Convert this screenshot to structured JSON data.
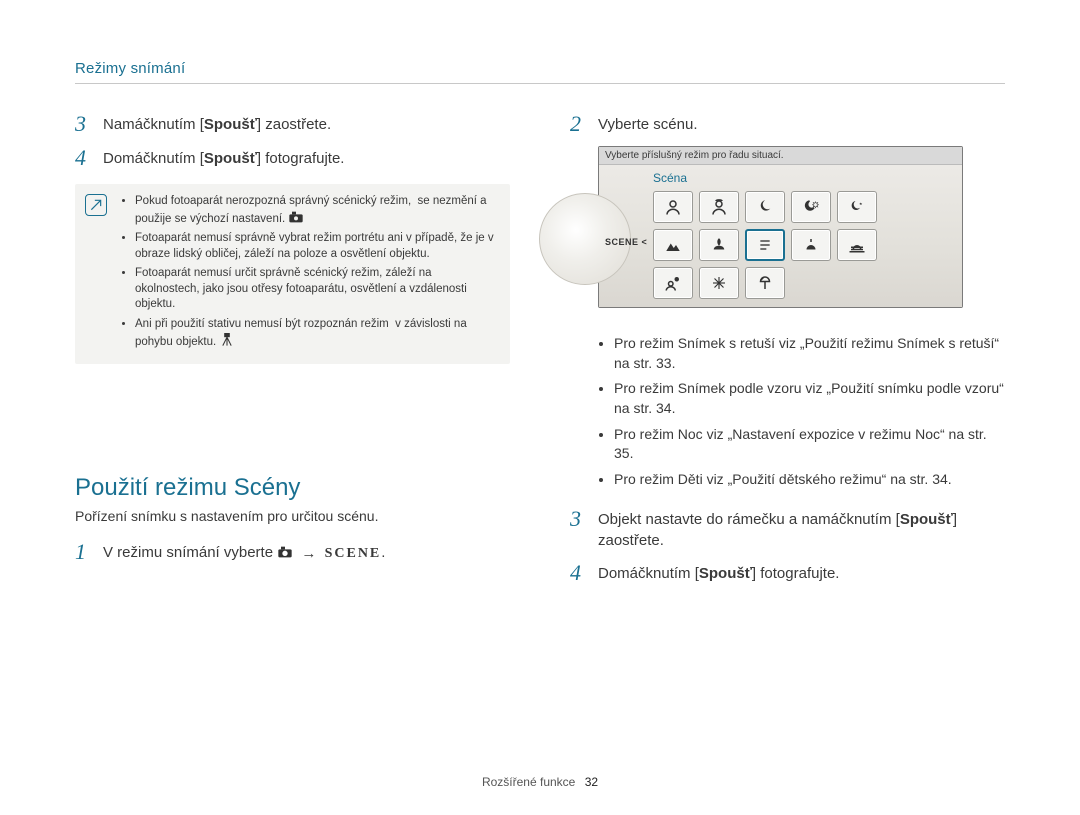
{
  "header": "Režimy snímání",
  "left": {
    "steps": [
      {
        "n": "3",
        "pre": "Namáčknutím [",
        "bold": "Spoušť",
        "post": "] zaostřete."
      },
      {
        "n": "4",
        "pre": "Domáčknutím [",
        "bold": "Spoušť",
        "post": "] fotografujte."
      }
    ],
    "notes": [
      "Pokud fotoaparát nerozpozná správný scénický režim,  se nezmění a použije se výchozí nastavení.",
      "Fotoaparát nemusí správně vybrat režim portrétu ani v případě, že je v obraze lidský obličej, záleží na poloze a osvětlení objektu.",
      "Fotoaparát nemusí určit správně scénický režim, záleží na okolnostech, jako jsou otřesy fotoaparátu, osvětlení a vzdálenosti objektu.",
      "Ani při použití stativu nemusí být rozpoznán režim  v závislosti na pohybu objektu."
    ],
    "section": {
      "title": "Použití režimu Scény",
      "desc": "Pořízení snímku s nastavením pro určitou scénu.",
      "step1": {
        "n": "1",
        "text_pre": "V režimu snímání vyberte ",
        "scene": "SCENE",
        "text_post": "."
      }
    }
  },
  "right": {
    "step2": {
      "n": "2",
      "text": "Vyberte scénu."
    },
    "display": {
      "hint": "Vyberte příslušný režim pro řadu situací.",
      "label": "Scéna",
      "side_tag": "SCENE <",
      "icons": [
        "portrait",
        "children",
        "landscape",
        "night-portrait",
        "night",
        "landscape2",
        "macro",
        "text",
        "sunset",
        "dawn",
        "backlight",
        "firework",
        "beach-snow"
      ]
    },
    "expl": [
      "Pro režim Snímek s retuší viz „Použití režimu Snímek s retuší“ na str. 33.",
      "Pro režim Snímek podle vzoru viz „Použití snímku podle vzoru“ na str. 34.",
      "Pro režim Noc viz „Nastavení expozice v režimu Noc“ na str. 35.",
      "Pro režim Děti viz „Použití dětského režimu“ na str. 34."
    ],
    "step3": {
      "n": "3",
      "pre": "Objekt nastavte do rámečku a namáčknutím [",
      "bold": "Spoušť",
      "post": "] zaostřete."
    },
    "step4": {
      "n": "4",
      "pre": "Domáčknutím [",
      "bold": "Spoušť",
      "post": "] fotografujte."
    }
  },
  "footer": {
    "section": "Rozšířené funkce",
    "page": "32"
  }
}
